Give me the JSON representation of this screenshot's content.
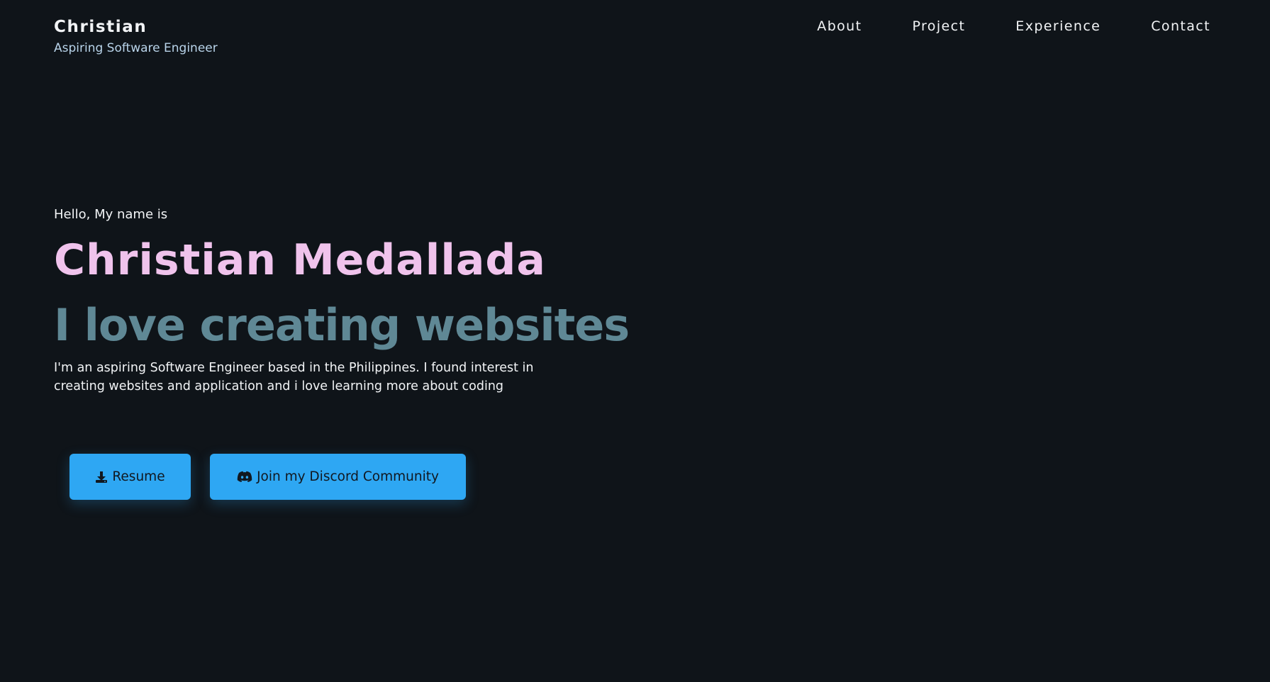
{
  "header": {
    "brand_name": "Christian",
    "brand_tagline": "Aspiring Software Engineer",
    "nav": [
      {
        "label": "About"
      },
      {
        "label": "Project"
      },
      {
        "label": "Experience"
      },
      {
        "label": "Contact"
      }
    ]
  },
  "hero": {
    "greeting": "Hello, My name is",
    "name": "Christian Medallada",
    "headline": "I love creating websites",
    "description": "I'm an aspiring Software Engineer based in the Philippines. I found interest in creating websites and application and i love learning more about coding"
  },
  "actions": {
    "resume_label": "Resume",
    "resume_icon": "download-icon",
    "discord_label": "Join my Discord Community",
    "discord_icon": "discord-icon"
  },
  "colors": {
    "background": "#0f1419",
    "name_accent": "#f0c3ec",
    "headline_accent": "#5f8895",
    "button": "#2ea7f3",
    "tagline": "#b9d4ea"
  }
}
